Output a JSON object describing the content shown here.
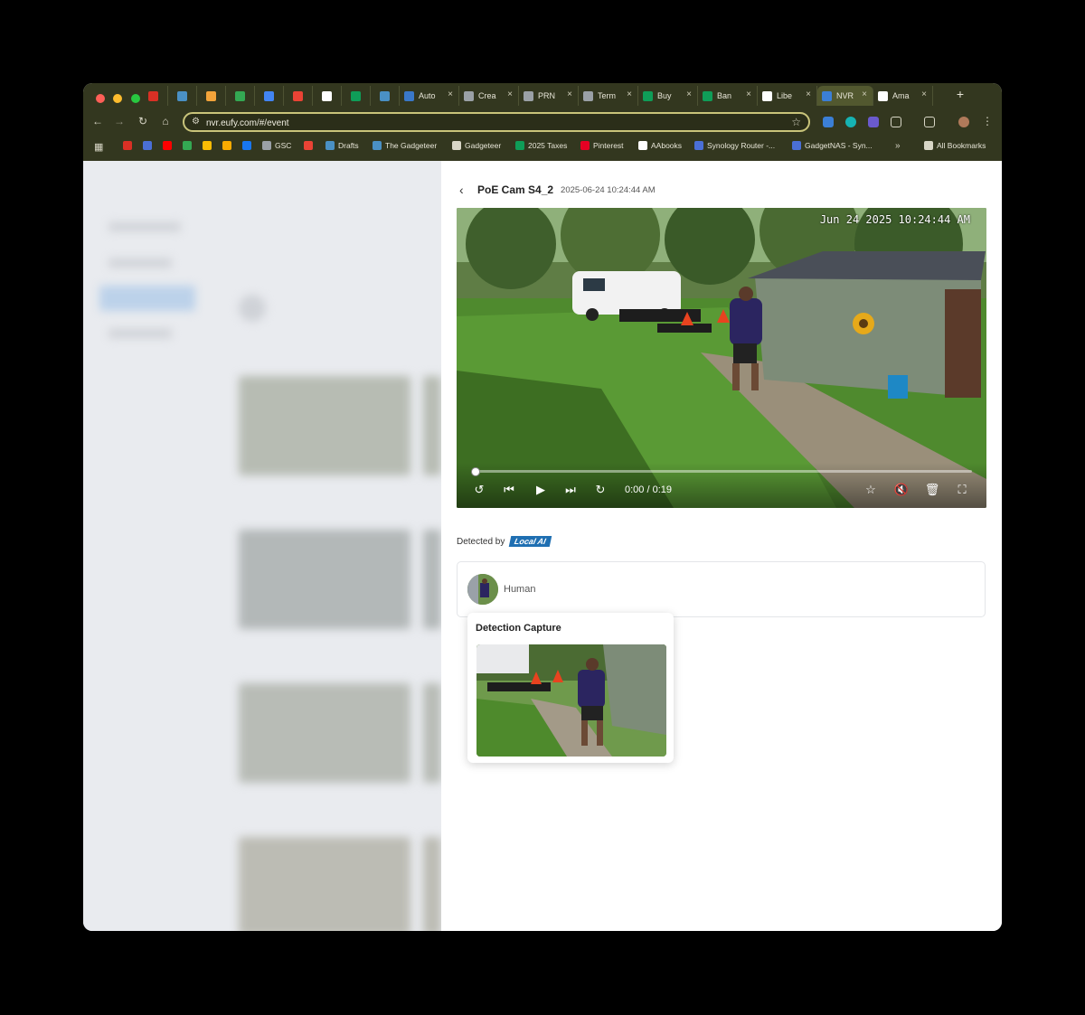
{
  "browser": {
    "tabs": [
      {
        "title": "",
        "pinned": true,
        "icon": "gmail-icon",
        "color": "#d93025"
      },
      {
        "title": "",
        "pinned": true,
        "icon": "gadgeteer-icon",
        "color": "#4a90c4"
      },
      {
        "title": "",
        "pinned": true,
        "icon": "orange-circle-icon",
        "color": "#f2a33a"
      },
      {
        "title": "",
        "pinned": true,
        "icon": "green-diamond-icon",
        "color": "#34a853"
      },
      {
        "title": "",
        "pinned": true,
        "icon": "blue-gear-icon",
        "color": "#4285f4"
      },
      {
        "title": "",
        "pinned": true,
        "icon": "red-circle-icon",
        "color": "#ea4335"
      },
      {
        "title": "",
        "pinned": true,
        "icon": "amazon-icon",
        "color": "#ffffff"
      },
      {
        "title": "",
        "pinned": true,
        "icon": "sheets-icon",
        "color": "#0f9d58"
      },
      {
        "title": "",
        "pinned": true,
        "icon": "gadgeteer-icon",
        "color": "#4a90c4"
      },
      {
        "title": "Auto",
        "pinned": false,
        "icon": "document-icon",
        "color": "#3a78c9"
      },
      {
        "title": "Crea",
        "pinned": false,
        "icon": "globe-icon",
        "color": "#9aa0a6"
      },
      {
        "title": "PRN",
        "pinned": false,
        "icon": "openai-icon",
        "color": "#9aa0a6"
      },
      {
        "title": "Term",
        "pinned": false,
        "icon": "globe-icon",
        "color": "#9aa0a6"
      },
      {
        "title": "Buy",
        "pinned": false,
        "icon": "sheets-icon",
        "color": "#0f9d58"
      },
      {
        "title": "Ban",
        "pinned": false,
        "icon": "sheets-icon",
        "color": "#0f9d58"
      },
      {
        "title": "Libe",
        "pinned": false,
        "icon": "notion-icon",
        "color": "#ffffff"
      },
      {
        "title": "NVR",
        "pinned": false,
        "active": true,
        "icon": "eufy-icon",
        "color": "#3b7fd6"
      },
      {
        "title": "Ama",
        "pinned": false,
        "icon": "amazon-icon",
        "color": "#ffffff"
      }
    ],
    "url": "nvr.eufy.com/#/event",
    "bookmarks": [
      {
        "label": "",
        "icon": "gmail-icon",
        "color": "#d93025"
      },
      {
        "label": "",
        "icon": "ob-icon",
        "color": "#4a6fd6"
      },
      {
        "label": "",
        "icon": "youtube-icon",
        "color": "#ff0000"
      },
      {
        "label": "",
        "icon": "drive-icon",
        "color": "#34a853"
      },
      {
        "label": "",
        "icon": "keep-icon",
        "color": "#fbbc04"
      },
      {
        "label": "",
        "icon": "analytics-icon",
        "color": "#f9ab00"
      },
      {
        "label": "",
        "icon": "facebook-icon",
        "color": "#1877f2"
      },
      {
        "label": "GSC",
        "icon": "gsc-icon",
        "color": "#9aa0a6"
      },
      {
        "label": "",
        "icon": "pinwheel-icon",
        "color": "#ea4335"
      },
      {
        "label": "Drafts",
        "icon": "gadgeteer-icon",
        "color": "#4a90c4"
      },
      {
        "label": "The Gadgeteer",
        "icon": "gadgeteer-icon",
        "color": "#4a90c4"
      },
      {
        "label": "Gadgeteer",
        "icon": "folder-icon",
        "color": "#d8d6c6"
      },
      {
        "label": "2025 Taxes",
        "icon": "sheets-icon",
        "color": "#0f9d58"
      },
      {
        "label": "Pinterest",
        "icon": "pinterest-icon",
        "color": "#e60023"
      },
      {
        "label": "AAbooks",
        "icon": "aabooks-icon",
        "color": "#ffffff"
      },
      {
        "label": "Synology Router -...",
        "icon": "synology-icon",
        "color": "#4a6fd6"
      },
      {
        "label": "GadgetNAS - Syn...",
        "icon": "synology-icon",
        "color": "#4a6fd6"
      },
      {
        "label": "All Bookmarks",
        "icon": "folder-icon",
        "color": "#d8d6c6"
      }
    ]
  },
  "event": {
    "camera_name": "PoE Cam S4_2",
    "timestamp": "2025-06-24 10:24:44 AM",
    "video_overlay_time": "Jun 24 2025  10:24:44 AM",
    "time_code": "0:00 / 0:19",
    "progress_fraction": 0.0,
    "detected_by_label": "Detected by",
    "detected_by_badge": "Local AI",
    "detection_label": "Human",
    "capture_title": "Detection Capture"
  },
  "colors": {
    "chrome_bg": "#33371f",
    "omnibox_border": "#c9c47a",
    "badge": "#1f6fb2"
  }
}
